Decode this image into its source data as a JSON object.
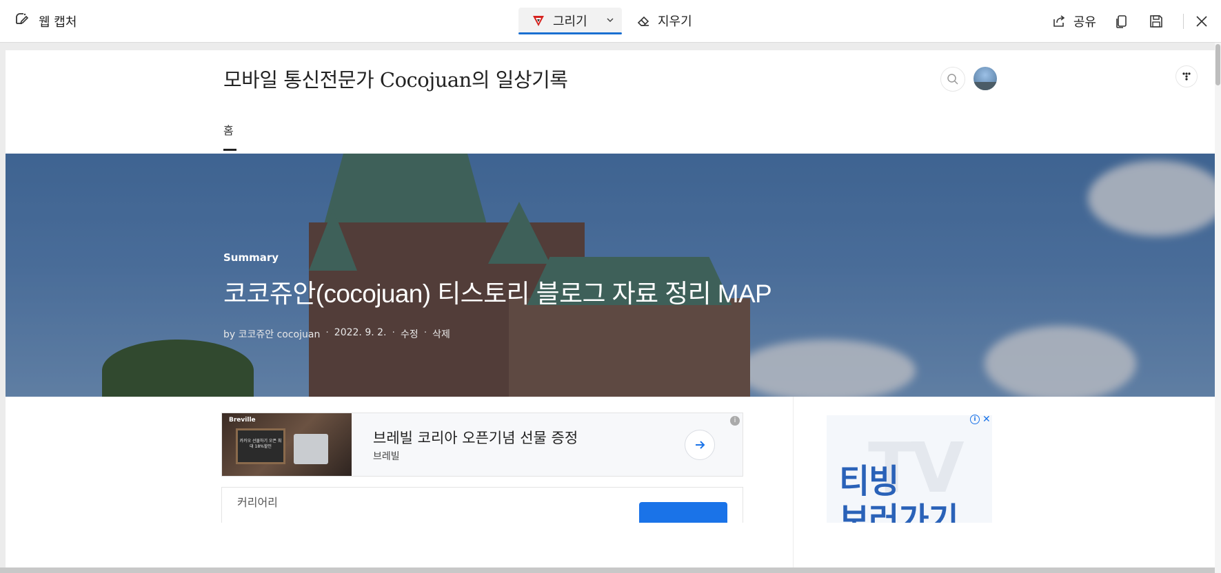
{
  "toolbar": {
    "app_title": "웹 캡처",
    "draw_label": "그리기",
    "erase_label": "지우기",
    "share_label": "공유",
    "accent_color": "#1a6fd1",
    "icons": [
      "web-capture-icon",
      "pen-icon",
      "chevron-down-icon",
      "eraser-icon",
      "share-icon",
      "copy-icon",
      "save-icon",
      "close-icon"
    ]
  },
  "blog": {
    "title": "모바일 통신전문가 Cocojuan의 일상기록",
    "nav_home": "홈"
  },
  "post": {
    "category": "Summary",
    "title": "코코쥬안(cocojuan) 티스토리 블로그 자료 정리 MAP",
    "author": "by 코코쥬안 cocojuan",
    "date": "2022. 9. 2.",
    "edit": "수정",
    "delete": "삭제",
    "meta_separator": "·"
  },
  "ad_banner": {
    "image_brand": "Breville",
    "image_text": "카카오 선물하기 오픈 최대 18%할인",
    "title": "브레빌 코리아 오픈기념 선물 증정",
    "advertiser": "브레빌",
    "info_glyph": "i"
  },
  "ad_second": {
    "label": "커리어리"
  },
  "side_ad": {
    "line1": "티빙",
    "line2": "보러가기",
    "bg_text": "TV",
    "info_glyph": "i",
    "close_glyph": "✕"
  }
}
